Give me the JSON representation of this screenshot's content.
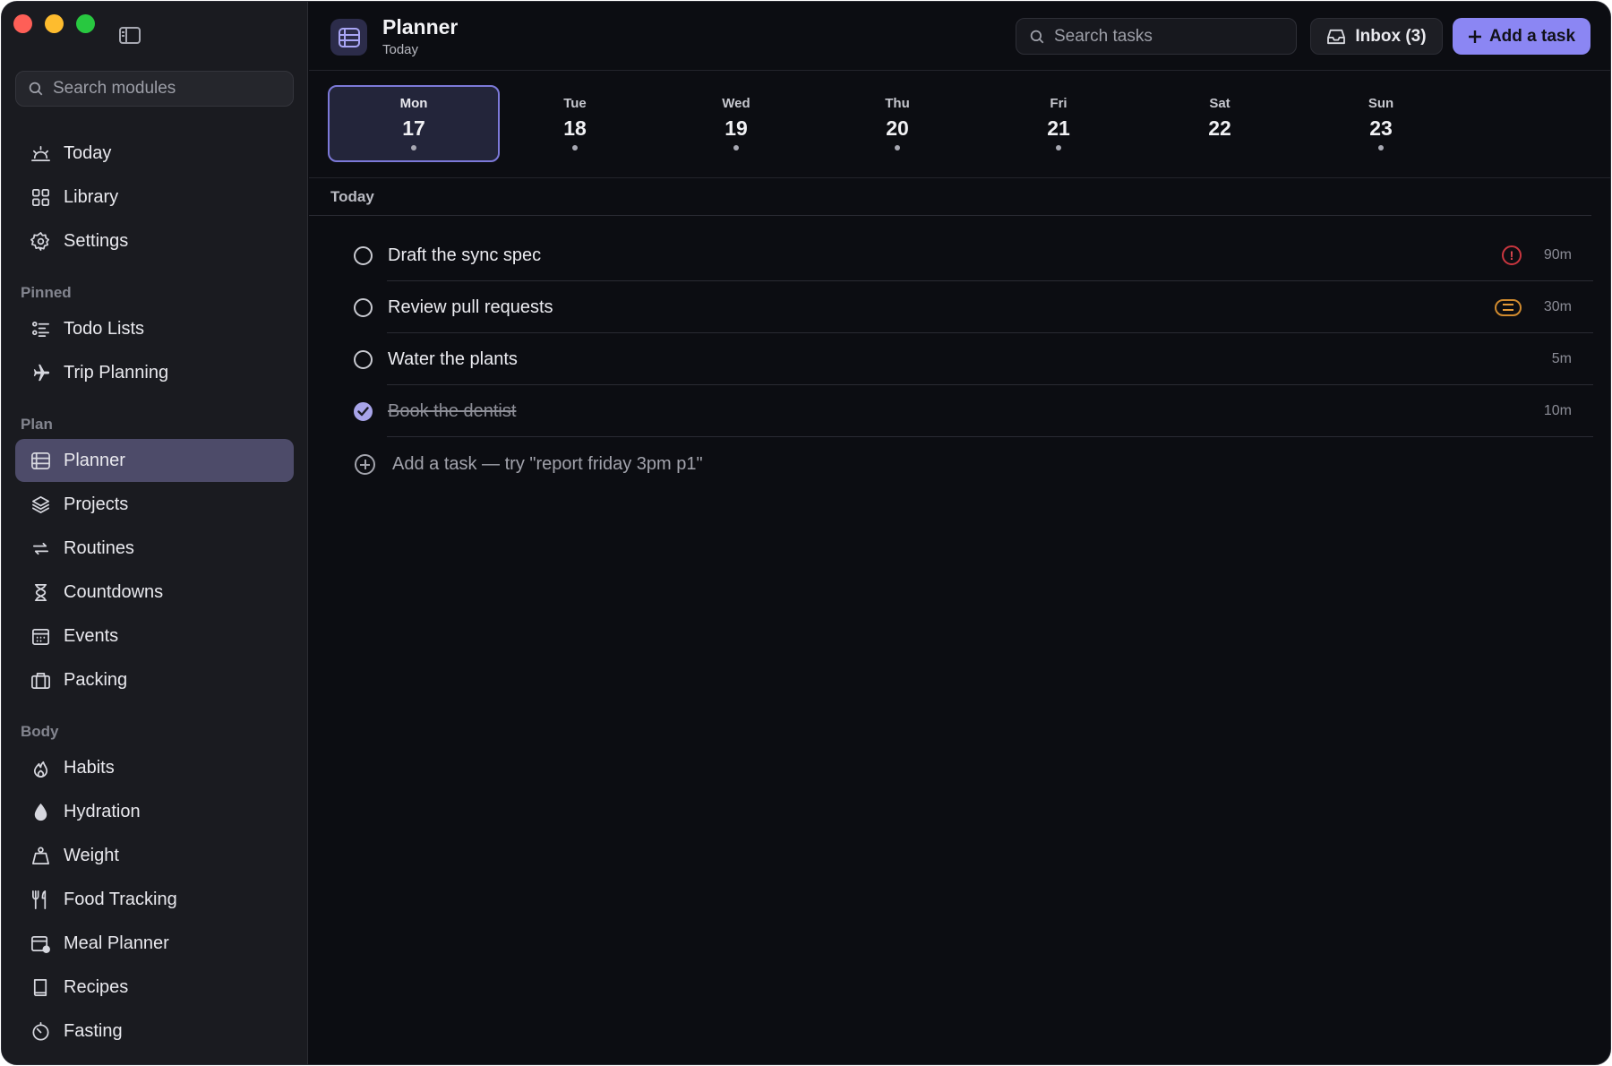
{
  "sidebar": {
    "search_placeholder": "Search modules",
    "top_items": [
      {
        "label": "Today",
        "icon": "sun-horizon-icon"
      },
      {
        "label": "Library",
        "icon": "grid-icon"
      },
      {
        "label": "Settings",
        "icon": "gear-icon"
      }
    ],
    "sections": [
      {
        "title": "Pinned",
        "items": [
          {
            "label": "Todo Lists",
            "icon": "list-icon"
          },
          {
            "label": "Trip Planning",
            "icon": "airplane-icon"
          }
        ]
      },
      {
        "title": "Plan",
        "items": [
          {
            "label": "Planner",
            "icon": "planner-icon",
            "active": true
          },
          {
            "label": "Projects",
            "icon": "layers-icon"
          },
          {
            "label": "Routines",
            "icon": "repeat-icon"
          },
          {
            "label": "Countdowns",
            "icon": "hourglass-icon"
          },
          {
            "label": "Events",
            "icon": "calendar-icon"
          },
          {
            "label": "Packing",
            "icon": "suitcase-icon"
          }
        ]
      },
      {
        "title": "Body",
        "items": [
          {
            "label": "Habits",
            "icon": "flame-icon"
          },
          {
            "label": "Hydration",
            "icon": "droplet-icon"
          },
          {
            "label": "Weight",
            "icon": "weight-icon"
          },
          {
            "label": "Food Tracking",
            "icon": "fork-knife-icon"
          },
          {
            "label": "Meal Planner",
            "icon": "meal-calendar-icon"
          },
          {
            "label": "Recipes",
            "icon": "book-icon"
          },
          {
            "label": "Fasting",
            "icon": "timer-icon"
          }
        ]
      }
    ]
  },
  "header": {
    "title": "Planner",
    "subtitle": "Today",
    "search_placeholder": "Search tasks",
    "inbox_label": "Inbox (3)",
    "add_label": "Add a task"
  },
  "week": [
    {
      "name": "Mon",
      "num": "17",
      "dot": true,
      "selected": true
    },
    {
      "name": "Tue",
      "num": "18",
      "dot": true
    },
    {
      "name": "Wed",
      "num": "19",
      "dot": true
    },
    {
      "name": "Thu",
      "num": "20",
      "dot": true
    },
    {
      "name": "Fri",
      "num": "21",
      "dot": true
    },
    {
      "name": "Sat",
      "num": "22",
      "dot": false
    },
    {
      "name": "Sun",
      "num": "23",
      "dot": true
    }
  ],
  "tasks_section": {
    "label": "Today",
    "tasks": [
      {
        "title": "Draft the sync spec",
        "duration": "90m",
        "priority": "high",
        "done": false
      },
      {
        "title": "Review pull requests",
        "duration": "30m",
        "priority": "medium",
        "done": false
      },
      {
        "title": "Water the plants",
        "duration": "5m",
        "priority": "none",
        "done": false
      },
      {
        "title": "Book the dentist",
        "duration": "10m",
        "priority": "none",
        "done": true
      }
    ],
    "add_hint": "Add a task — try \"report friday 3pm p1\""
  },
  "colors": {
    "accent": "#8b86f3",
    "active_nav": "#4d4b69",
    "priority_high": "#e04a52",
    "priority_medium": "#e39a39"
  }
}
